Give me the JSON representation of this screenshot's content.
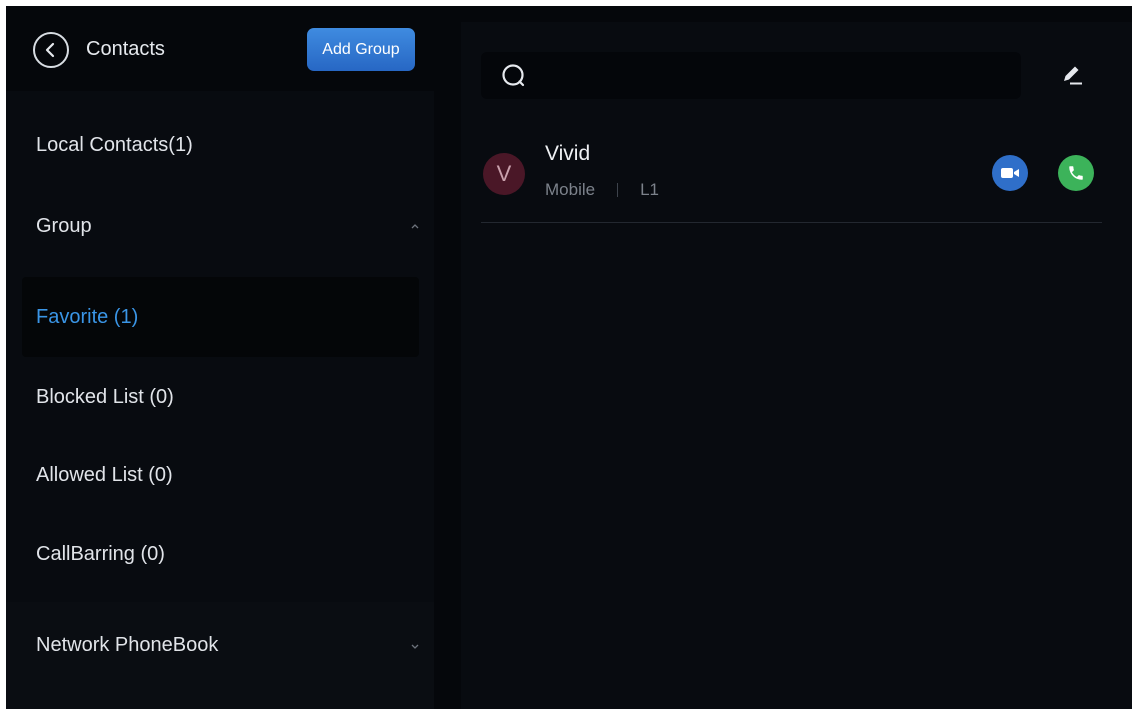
{
  "header": {
    "title": "Contacts",
    "add_group_label": "Add Group",
    "back_icon": "chevron-left-icon"
  },
  "sidebar": {
    "items": [
      {
        "label": "Local Contacts(1)"
      },
      {
        "label": "Group",
        "icon": "chevron-up-icon"
      },
      {
        "label": "Favorite  (1)",
        "selected": true
      },
      {
        "label": "Blocked List  (0)"
      },
      {
        "label": "Allowed List  (0)"
      },
      {
        "label": "CallBarring  (0)"
      },
      {
        "label": "Network PhoneBook",
        "icon": "chevron-down-icon"
      }
    ]
  },
  "search": {
    "placeholder": "",
    "icon": "search-icon",
    "edit_icon": "edit-icon"
  },
  "contacts": [
    {
      "initial": "V",
      "name": "Vivid",
      "type": "Mobile",
      "line": "L1",
      "actions": [
        "video-call-icon",
        "phone-icon"
      ]
    }
  ],
  "colors": {
    "accent": "#3a95e6",
    "add_group_button": "#2f78d6",
    "avatar_bg": "#4a1727",
    "video_button": "#2f6fc9",
    "call_button": "#3cb35a",
    "background": "#080b10"
  }
}
